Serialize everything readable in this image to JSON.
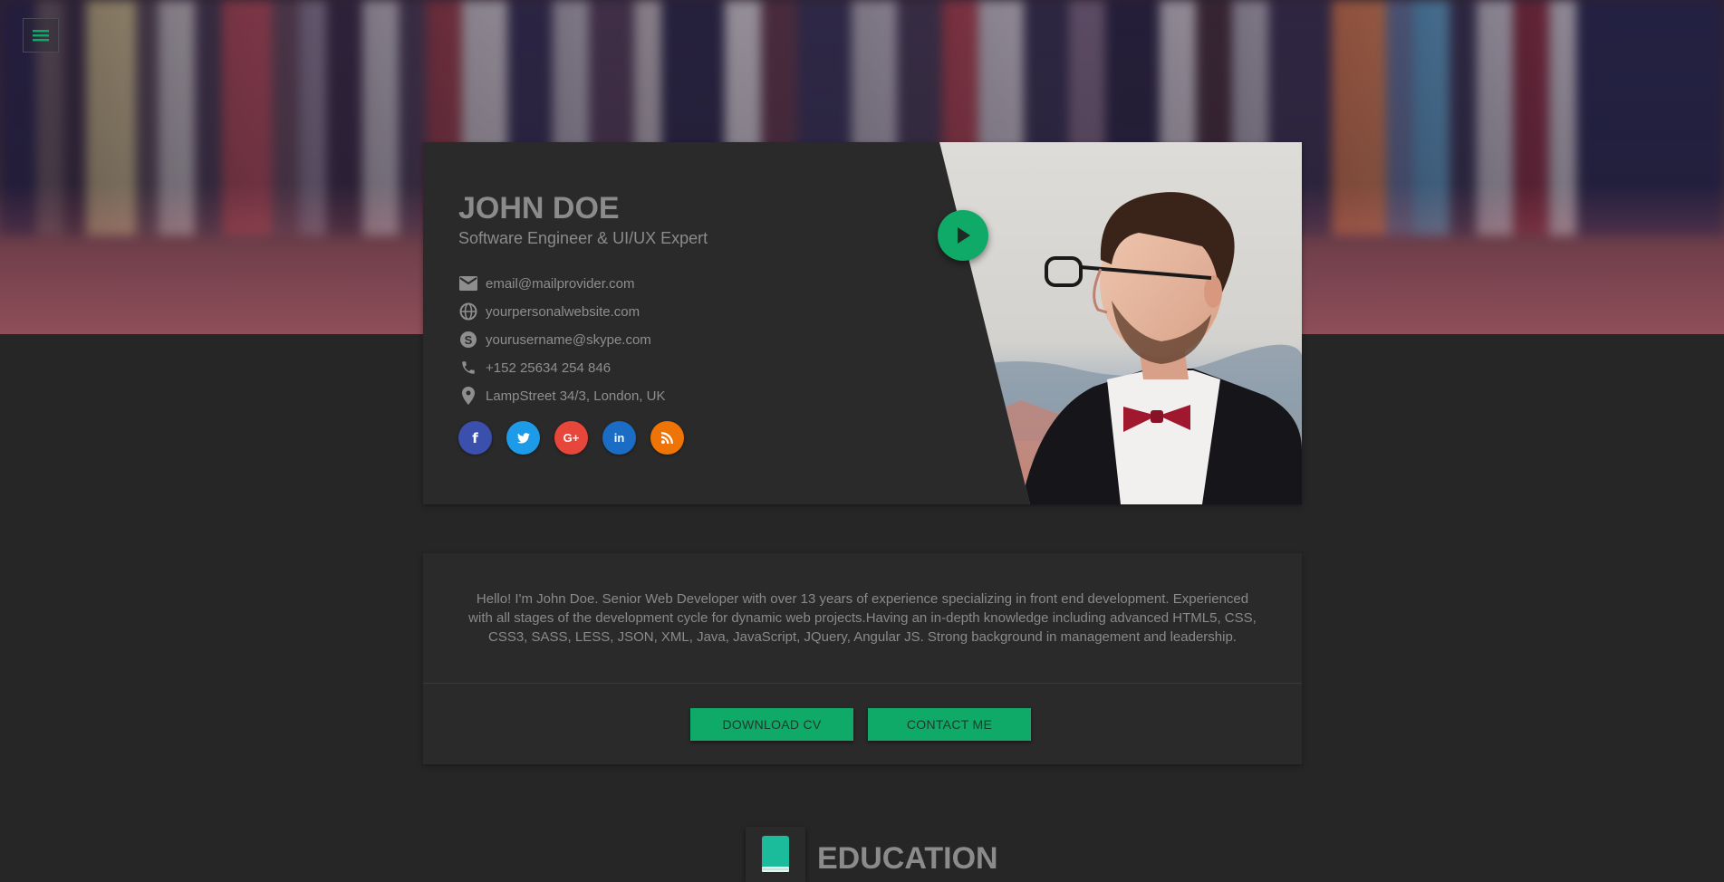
{
  "profile": {
    "name": "JOHN DOE",
    "title": "Software Engineer & UI/UX Expert",
    "contacts": [
      {
        "icon": "mail-icon",
        "text": "email@mailprovider.com"
      },
      {
        "icon": "globe-icon",
        "text": "yourpersonalwebsite.com"
      },
      {
        "icon": "skype-icon",
        "text": "yourusername@skype.com"
      },
      {
        "icon": "phone-icon",
        "text": "+152 25634 254 846"
      },
      {
        "icon": "location-pin-icon",
        "text": "LampStreet 34/3, London, UK"
      }
    ],
    "socials": [
      {
        "name": "facebook",
        "glyph": "f",
        "color": "#3b4fad"
      },
      {
        "name": "twitter",
        "glyph": "t",
        "color": "#1d9ae8"
      },
      {
        "name": "google-plus",
        "glyph": "G+",
        "color": "#e7463a"
      },
      {
        "name": "linkedin",
        "glyph": "in",
        "color": "#1a6cc4"
      },
      {
        "name": "rss",
        "glyph": "rss",
        "color": "#ee7405"
      }
    ]
  },
  "about": {
    "text": "Hello! I'm John Doe. Senior Web Developer with over 13 years of experience specializing in front end development. Experienced with all stages of the development cycle for dynamic web projects.Having an in-depth knowledge including advanced HTML5, CSS, CSS3, SASS, LESS, JSON, XML, Java, JavaScript, JQuery, Angular JS. Strong background in management and leadership.",
    "download_label": "DOWNLOAD CV",
    "contact_label": "CONTACT ME"
  },
  "education": {
    "title": "EDUCATION"
  },
  "colors": {
    "accent": "#0fa968",
    "background": "#262626",
    "card": "#2a2a2a"
  }
}
